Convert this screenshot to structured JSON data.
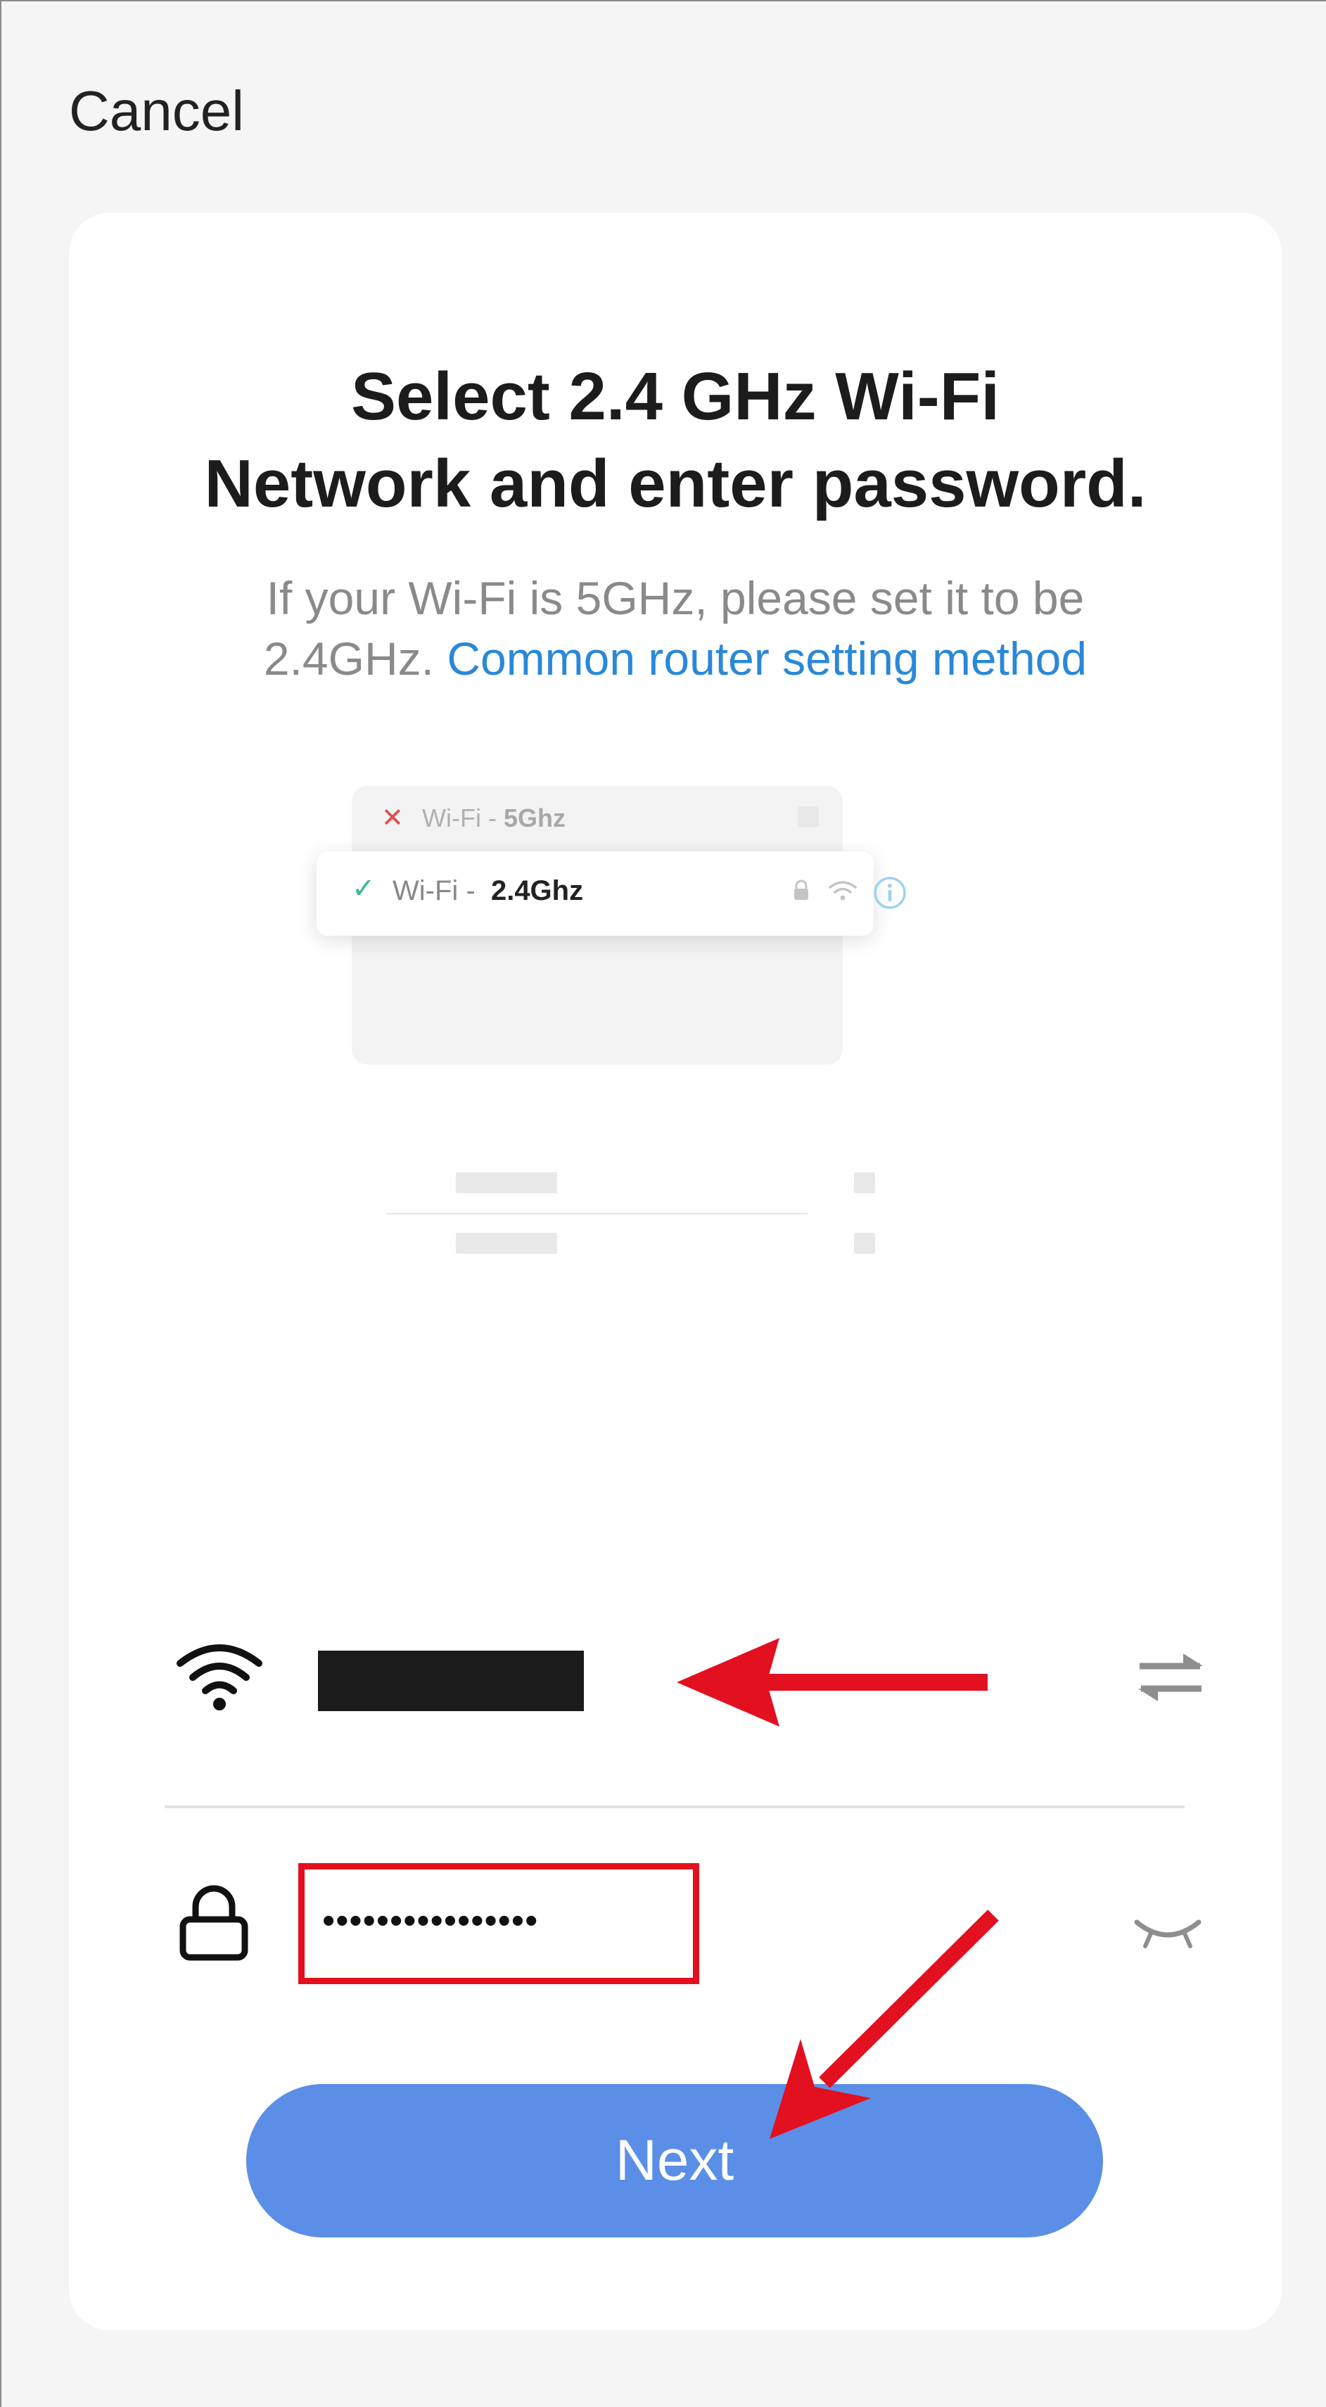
{
  "header": {
    "cancel_label": "Cancel"
  },
  "main": {
    "title_line1": "Select 2.4 GHz Wi-Fi",
    "title_line2": "Network and enter password.",
    "subtitle_line1": "If your Wi-Fi is 5GHz, please set it to be",
    "subtitle_line2_prefix": "2.4GHz.",
    "subtitle_link": "Common router setting method"
  },
  "illustration": {
    "row1_prefix": "Wi-Fi -",
    "row1_band": "5Ghz",
    "row2_prefix": "Wi-Fi -",
    "row2_band": "2.4Ghz"
  },
  "form": {
    "password_value": "••••••••••••••••",
    "next_label": "Next"
  },
  "colors": {
    "link": "#2a88d8",
    "button": "#5b8fe7",
    "annotation": "#e3101f",
    "check": "#3cb88e",
    "cross": "#e04b4b"
  },
  "icons": [
    "wifi-icon",
    "switch-network-icon",
    "lock-icon",
    "eye-closed-icon",
    "info-icon",
    "check-icon",
    "cross-icon"
  ]
}
